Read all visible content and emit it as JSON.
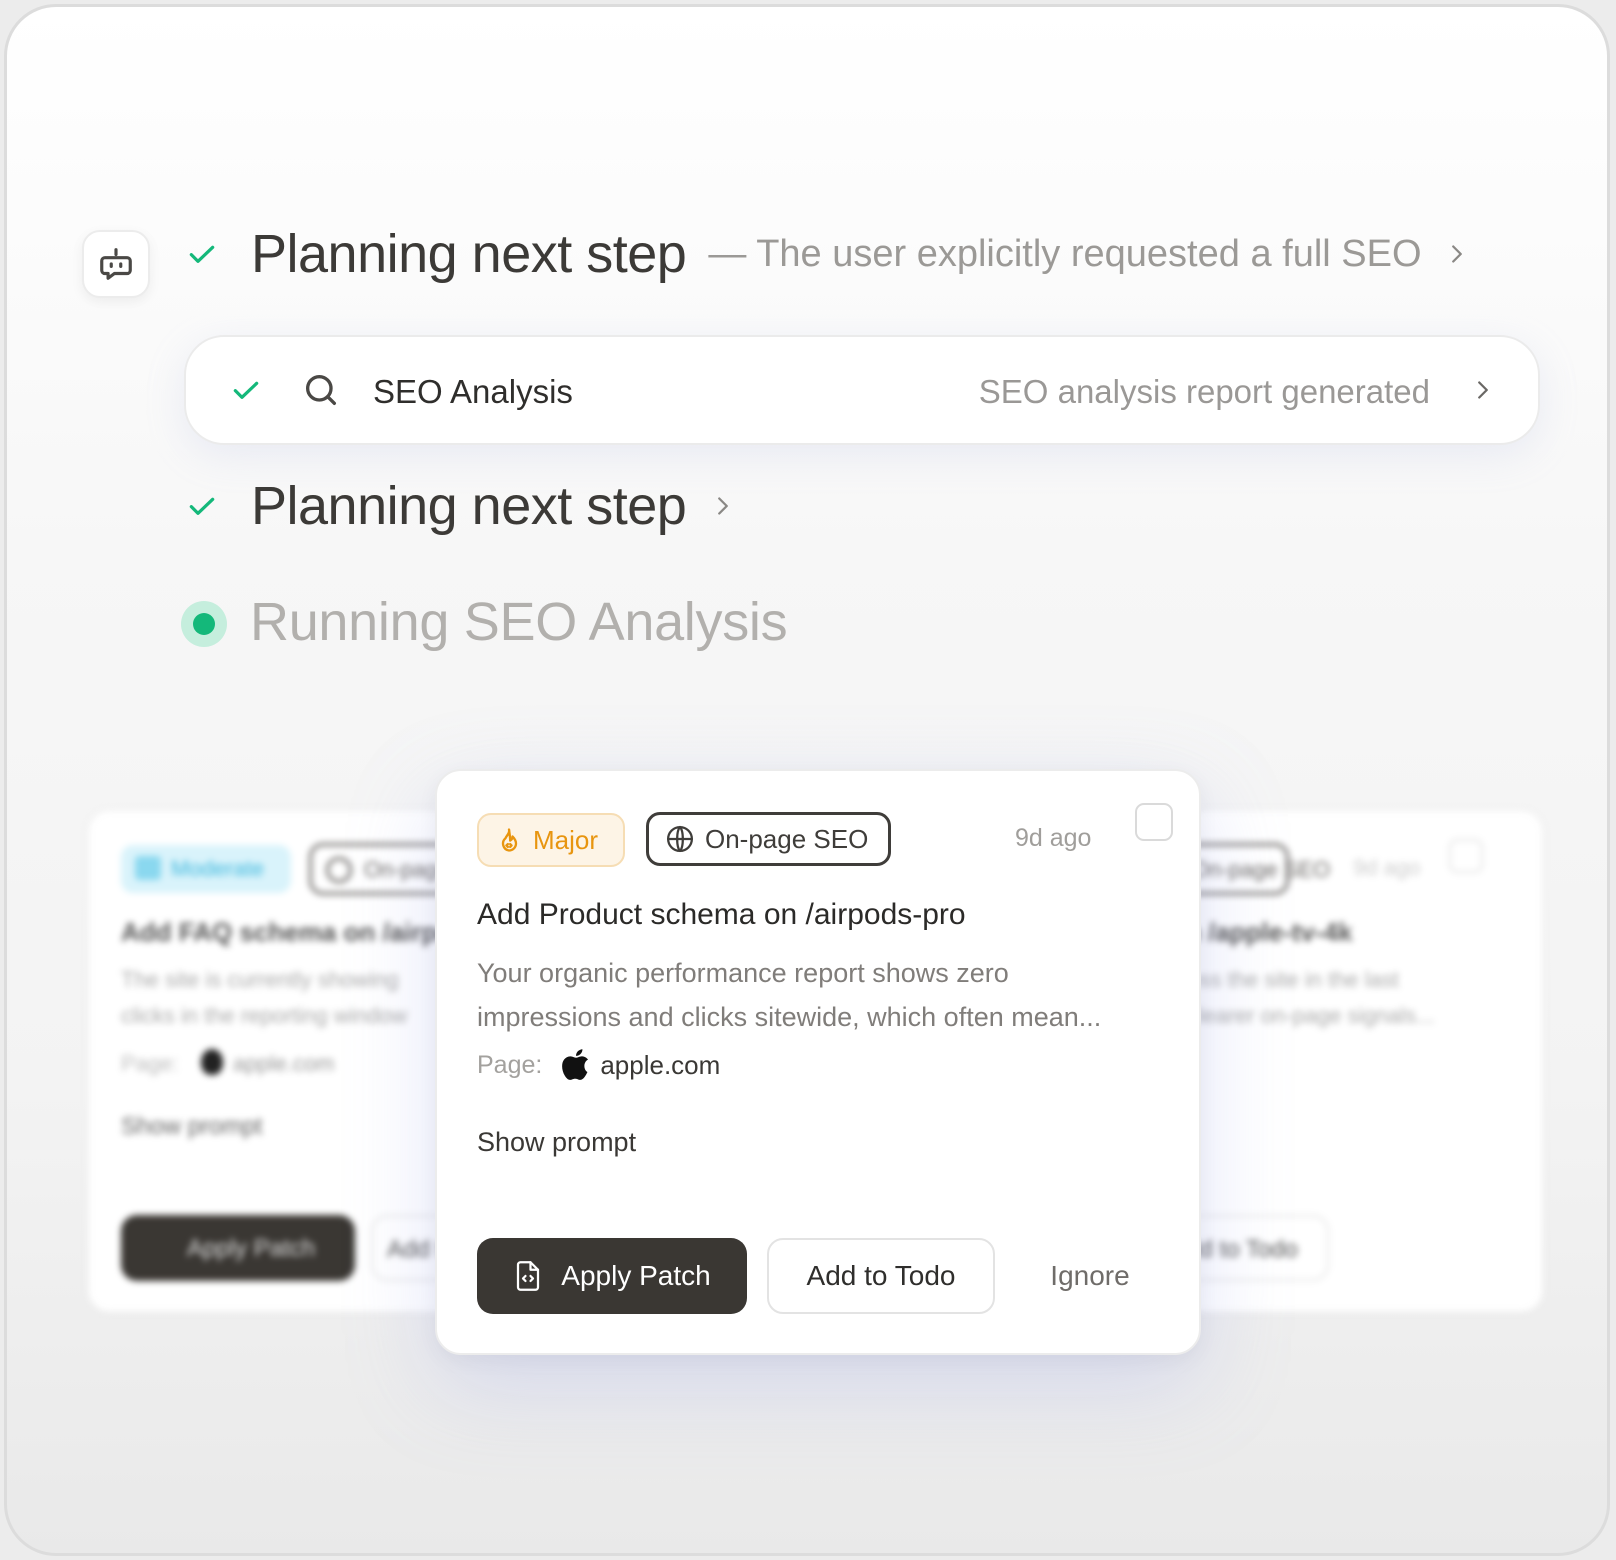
{
  "timeline": {
    "step1": {
      "title": "Planning next step",
      "subtitle": "— The user explicitly requested a full SEO"
    },
    "tool": {
      "name": "SEO Analysis",
      "status": "SEO analysis report generated"
    },
    "step2": {
      "title": "Planning next step"
    },
    "running": {
      "text": "Running SEO Analysis"
    }
  },
  "background_cards": {
    "left": {
      "severity": "Moderate",
      "category": "On-page SEO",
      "title": "Add FAQ schema on /airpods",
      "desc": [
        "The site is currently showing",
        "clicks in the reporting window"
      ],
      "page_label": "Page:",
      "page_value": "apple.com",
      "show_prompt": "Show prompt",
      "apply": "Apply Patch",
      "todo": "Add to Todo"
    },
    "right": {
      "category": "On-page SEO",
      "time": "9d ago",
      "title": "on /apple-tv-4k",
      "desc": [
        "cross the site in the last",
        "d clearer on-page signals..."
      ],
      "todo": "Add to Todo"
    }
  },
  "card": {
    "severity": "Major",
    "category": "On-page SEO",
    "time": "9d ago",
    "title": "Add Product schema on /airpods-pro",
    "desc_line1": "Your organic performance report shows zero",
    "desc_line2": "impressions and clicks sitewide, which often mean...",
    "page_label": "Page:",
    "page_value": "apple.com",
    "show_prompt": "Show prompt",
    "apply_label": "Apply Patch",
    "todo_label": "Add to Todo",
    "ignore_label": "Ignore"
  },
  "colors": {
    "check": "#14b87a",
    "running": "#14b87a",
    "major": "#e8950f",
    "moderate": "#3fb8dd",
    "dark_button": "#3a3733"
  },
  "icons": {
    "agent": "robot-chat-icon",
    "check": "check-icon",
    "search": "search-icon",
    "chevron": "chevron-right-icon",
    "major": "flame-icon",
    "category": "globe-icon",
    "page": "apple-logo-icon",
    "apply": "code-file-icon"
  }
}
